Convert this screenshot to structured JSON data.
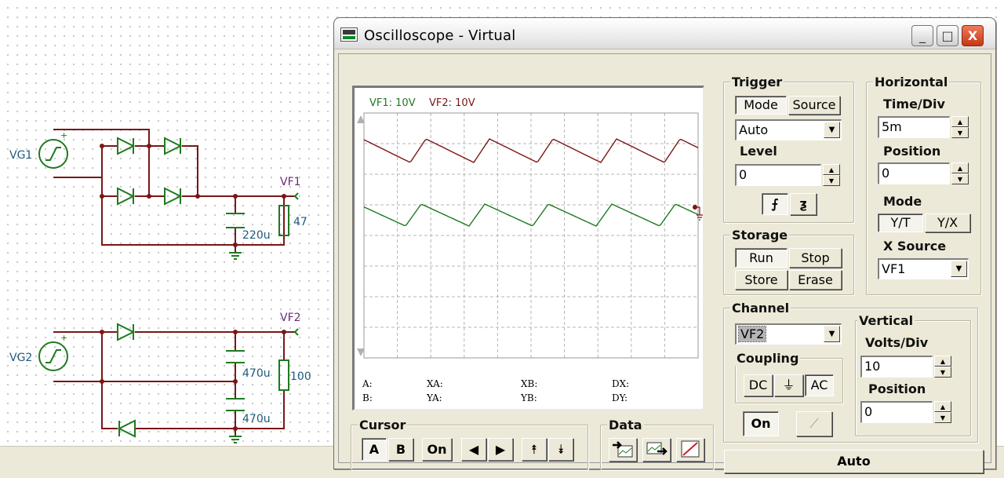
{
  "schematic": {
    "sources": [
      "VG1",
      "VG2"
    ],
    "probes": [
      "VF1",
      "VF2"
    ],
    "capacitors": [
      "220u",
      "470u",
      "470u"
    ],
    "resistors": [
      "47",
      "100"
    ]
  },
  "window": {
    "title": "Oscilloscope - Virtual",
    "controls": {
      "minimize": "_",
      "maximize": "□",
      "close": "X"
    }
  },
  "screen": {
    "ch1_label": "VF1: 10V",
    "ch2_label": "VF2: 10V",
    "ch1_color": "#7a1616",
    "ch2_color": "#1f7a1f",
    "readouts": {
      "a": "A:",
      "b": "B:",
      "xa": "XA:",
      "ya": "YA:",
      "xb": "XB:",
      "yb": "YB:",
      "dx": "DX:",
      "dy": "DY:"
    }
  },
  "trigger": {
    "title": "Trigger",
    "mode_btn": "Mode",
    "source_btn": "Source",
    "mode_value": "Auto",
    "level_label": "Level",
    "level_value": "0",
    "rising_icon": "rising-edge-icon",
    "falling_icon": "falling-edge-icon"
  },
  "horizontal": {
    "title": "Horizontal",
    "time_div_label": "Time/Div",
    "time_div_value": "5m",
    "position_label": "Position",
    "position_value": "0",
    "mode_label": "Mode",
    "yt_btn": "Y/T",
    "yx_btn": "Y/X",
    "xsource_label": "X Source",
    "xsource_value": "VF1"
  },
  "storage": {
    "title": "Storage",
    "run": "Run",
    "stop": "Stop",
    "store": "Store",
    "erase": "Erase"
  },
  "channel": {
    "title": "Channel",
    "value": "VF2",
    "coupling_label": "Coupling",
    "dc": "DC",
    "ground": "⏚",
    "ac": "AC",
    "on_btn": "On"
  },
  "vertical": {
    "title": "Vertical",
    "volts_div_label": "Volts/Div",
    "volts_div_value": "10",
    "position_label": "Position",
    "position_value": "0"
  },
  "cursor": {
    "title": "Cursor",
    "a": "A",
    "b": "B",
    "on": "On",
    "left": "◀",
    "right": "▶",
    "up": "⯭",
    "down": "⯯"
  },
  "data_group": {
    "title": "Data"
  },
  "auto_button": "Auto"
}
